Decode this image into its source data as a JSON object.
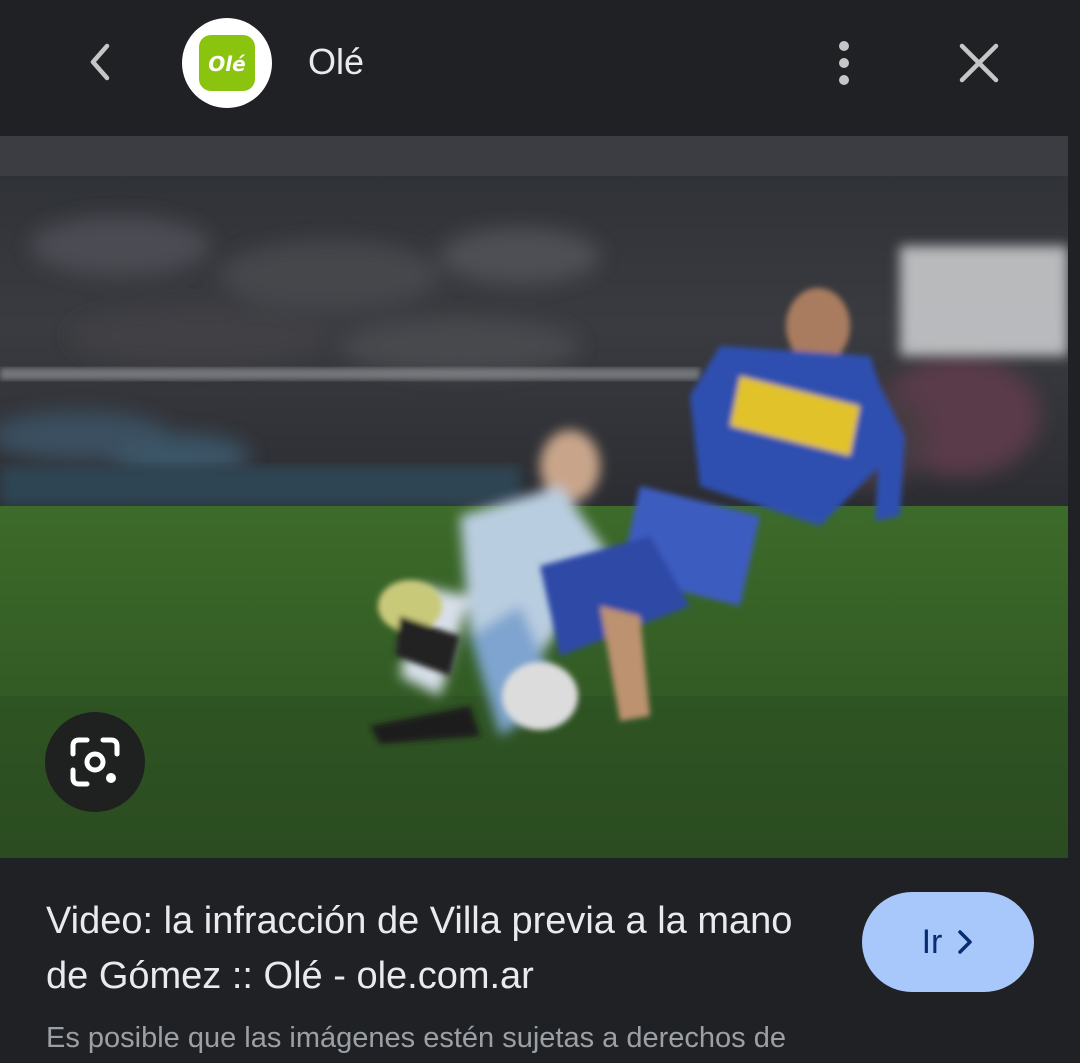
{
  "header": {
    "site_name": "Olé",
    "favicon_text": "Olé",
    "favicon_color": "#8bc40f",
    "back_icon": "chevron-left-icon",
    "more_icon": "more-vert-icon",
    "close_icon": "close-icon"
  },
  "image": {
    "lens_icon": "google-lens-icon"
  },
  "caption": {
    "title": "Video: la infracción de Villa previa a la mano de Gómez :: Olé - ole.com.ar",
    "go_label": "Ir",
    "go_icon": "chevron-right-icon",
    "go_button_color": "#a8c7fa",
    "copyright_notice": "Es posible que las imágenes estén sujetas a derechos de"
  }
}
